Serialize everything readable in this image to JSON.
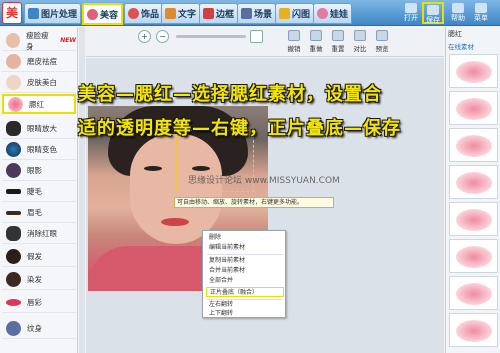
{
  "app": {
    "logo_glyph": "美"
  },
  "tabs": [
    {
      "label": "图片处理",
      "color": "#3d86c6"
    },
    {
      "label": "美容",
      "color": "#e0607a"
    },
    {
      "label": "饰品",
      "color": "#e05050"
    },
    {
      "label": "文字",
      "color": "#e08a30"
    },
    {
      "label": "边框",
      "color": "#d04040"
    },
    {
      "label": "场景",
      "color": "#5a6ea0"
    },
    {
      "label": "闪图",
      "color": "#e6b020"
    },
    {
      "label": "娃娃",
      "color": "#e07aa0"
    }
  ],
  "right_buttons": {
    "open": "打开",
    "save": "保存",
    "help": "帮助",
    "menu": "菜单",
    "info": "信息"
  },
  "sidebar": {
    "items": [
      {
        "label": "瘦脸瘦身",
        "badge": "NEW"
      },
      {
        "label": "磨皮祛痘"
      },
      {
        "label": "皮肤美白"
      },
      {
        "label": "腮红"
      },
      {
        "label": "眼睛放大"
      },
      {
        "label": "眼睛变色"
      },
      {
        "label": "眼影"
      },
      {
        "label": "睫毛"
      },
      {
        "label": "眉毛"
      },
      {
        "label": "消除红眼"
      },
      {
        "label": "假发"
      },
      {
        "label": "染发"
      },
      {
        "label": "唇彩"
      },
      {
        "label": "纹身"
      }
    ]
  },
  "toolbar": {
    "zoom_in": "+",
    "zoom_out": "−",
    "tools": [
      "撤销",
      "重做",
      "重置",
      "对比",
      "预览"
    ]
  },
  "canvas": {
    "tooltip": "可自由移动、缩放、旋转素材，右键更多功能。",
    "watermark": "思缘设计论坛 www.MISSYUAN.COM"
  },
  "context_menu": {
    "items": [
      "删除",
      "编辑当前素材",
      "复制当前素材",
      "合并当前素材",
      "全部合并",
      "正片叠底（融合）",
      "左右翻转",
      "上下翻转"
    ],
    "highlighted_index": 5
  },
  "right_panel": {
    "title": "腮红",
    "subtitle": "在线素材"
  },
  "caption": {
    "line1": "美容—腮红—选择腮红素材，设置合",
    "line2": "适的透明度等—右键，正片叠底—保存"
  }
}
